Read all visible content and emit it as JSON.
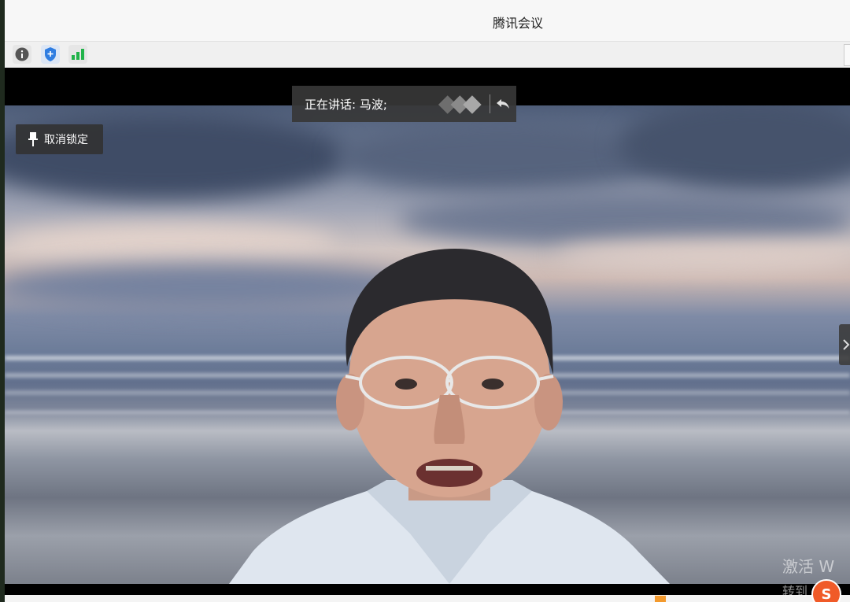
{
  "window": {
    "title": "腾讯会议"
  },
  "toolbar": {
    "icons": [
      "info-icon",
      "shield-icon",
      "signal-icon"
    ]
  },
  "speaker": {
    "label": "正在讲话: 马波;"
  },
  "pin": {
    "label": "取消锁定"
  },
  "watermark": {
    "line1": "激活 W",
    "line2": "转到"
  },
  "colors": {
    "shield": "#2f7de1",
    "signal": "#21b34a",
    "sogou": "#f05a28"
  }
}
